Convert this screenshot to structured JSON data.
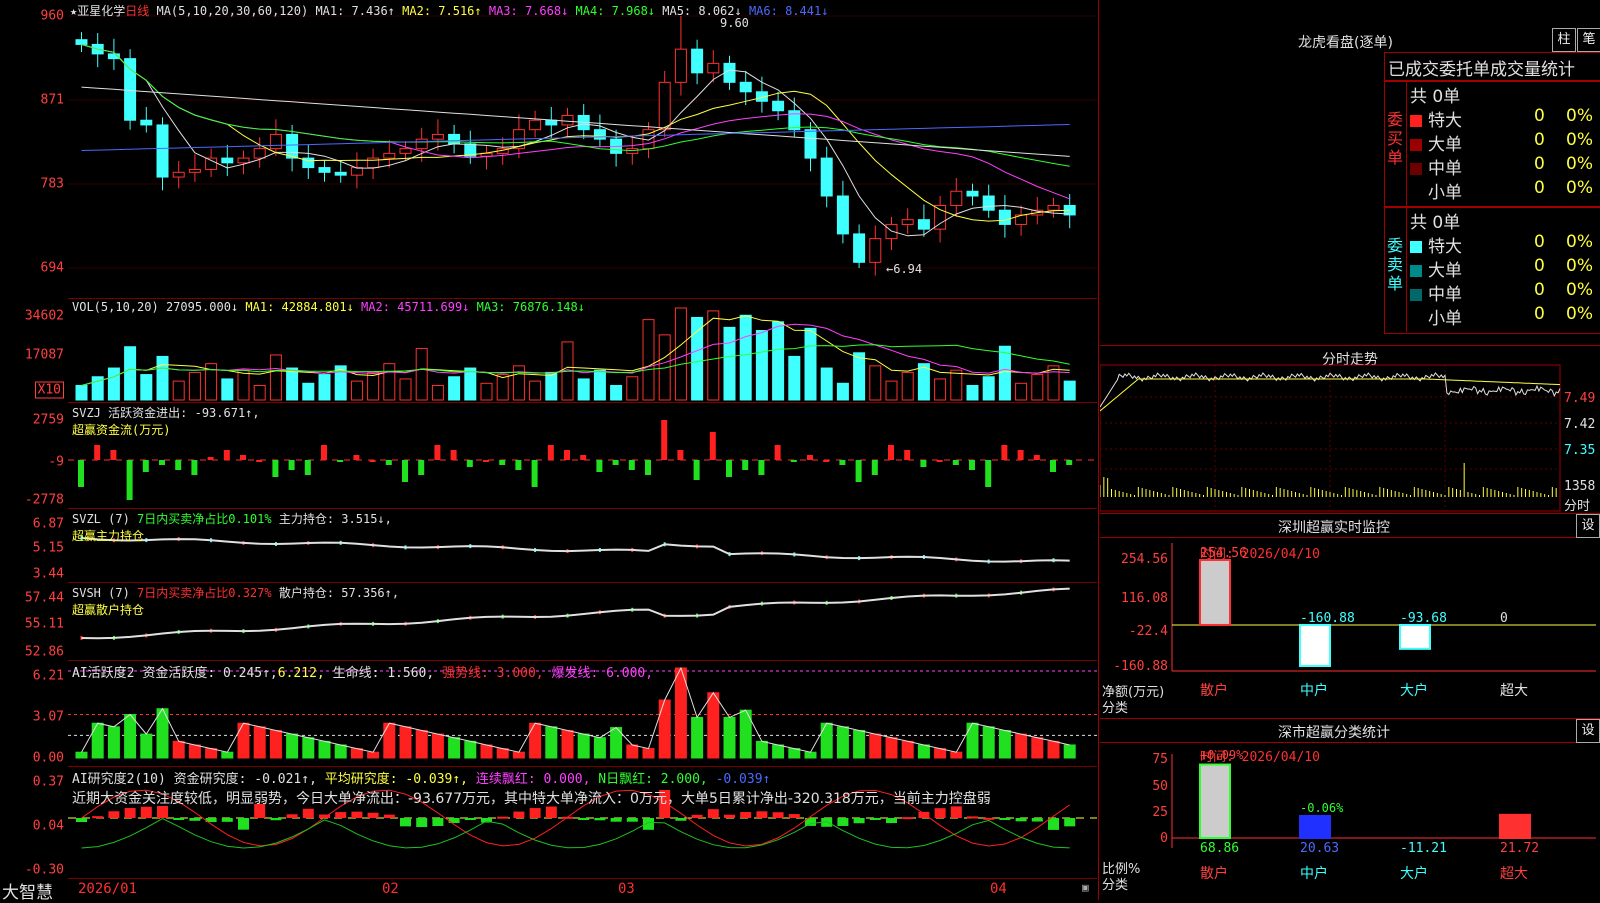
{
  "price": {
    "stock": "★亚星化学",
    "period": "日线",
    "ma_header": "MA(5,10,20,30,60,120)",
    "ma": [
      {
        "label": "MA1: 7.436↑",
        "color": "#e0e0e0"
      },
      {
        "label": "MA2: 7.516↑",
        "color": "#ffff40"
      },
      {
        "label": "MA3: 7.668↓",
        "color": "#ff40ff"
      },
      {
        "label": "MA4: 7.968↓",
        "color": "#30ff30"
      },
      {
        "label": "MA5: 8.062↓",
        "color": "#e0e0e0"
      },
      {
        "label": "MA6: 8.441↓",
        "color": "#4a6aff"
      }
    ],
    "axis": [
      "960",
      "871",
      "783",
      "694"
    ],
    "high_label": "9.60",
    "low_label": "←6.94"
  },
  "vol": {
    "header": "VOL(5,10,20)",
    "value": "27095.000↓",
    "ma": [
      {
        "label": "MA1: 42884.801↓",
        "color": "#ffff40"
      },
      {
        "label": "MA2: 45711.699↓",
        "color": "#ff40ff"
      },
      {
        "label": "MA3: 76876.148↓",
        "color": "#30ff30"
      }
    ],
    "axis": [
      "34602",
      "17087"
    ],
    "unit": "X10"
  },
  "svzj": {
    "header": "SVZJ",
    "label": "活跃资金进出: -93.671↑,",
    "sub": "超赢资金流(万元)",
    "axis": [
      "2759",
      "-9",
      "-2778"
    ]
  },
  "svzl": {
    "header": "SVZL (7)",
    "label": "7日内买卖净占比0.101%",
    "label2": "主力持仓: 3.515↓,",
    "sub": "超赢主力持仓",
    "axis": [
      "6.87",
      "5.15",
      "3.44"
    ]
  },
  "svsh": {
    "header": "SVSH (7)",
    "label": "7日内买卖净占比0.327%",
    "label2": "散户持仓: 57.356↑,",
    "sub": "超赢散户持仓",
    "axis": [
      "57.44",
      "55.11",
      "52.86"
    ]
  },
  "ai1": {
    "header": "AI活跃度2",
    "label": "资金活跃度: 0.245↑,",
    "v2": "6.212,",
    "v3": "生命线: 1.560,",
    "v4": "强势线: 3.000,",
    "v5": "爆发线: 6.000,",
    "axis": [
      "6.21",
      "3.07",
      "0.00"
    ]
  },
  "ai2": {
    "header": "AI研究度2(10)",
    "label": "资金研究度: -0.021↑,",
    "v2": "平均研究度: -0.039↑,",
    "v3": "连续飘红: 0.000,",
    "v4": "N日飘红: 2.000,",
    "v5": "-0.039↑",
    "desc": "近期大资金关注度较低，明显弱势，今日大单净流出：-93.677万元，其中特大单净流入：0万元，大单5日累计净出-320.318万元，当前主力控盘弱",
    "axis": [
      "0.37",
      "0.04",
      "-0.30"
    ]
  },
  "bottom": {
    "brand": "大智慧",
    "dates": [
      "2026/01",
      "02",
      "03",
      "04"
    ]
  },
  "lhb": {
    "title": "龙虎看盘(逐单)",
    "btn1": "柱",
    "btn2": "笔",
    "subtitle": "已成交委托单成交量统计",
    "buy": {
      "label": "委买单",
      "total": "共 0单",
      "rows": [
        {
          "name": "特大",
          "v": "0",
          "p": "0%",
          "color": "#ff2020"
        },
        {
          "name": "大单",
          "v": "0",
          "p": "0%",
          "color": "#9a0000"
        },
        {
          "name": "中单",
          "v": "0",
          "p": "0%",
          "color": "#6a0000"
        },
        {
          "name": "小单",
          "v": "0",
          "p": "0%",
          "color": "#000000"
        }
      ]
    },
    "sell": {
      "label": "委卖单",
      "total": "共 0单",
      "rows": [
        {
          "name": "特大",
          "v": "0",
          "p": "0%",
          "color": "#40ffff"
        },
        {
          "name": "大单",
          "v": "0",
          "p": "0%",
          "color": "#008a8a"
        },
        {
          "name": "中单",
          "v": "0",
          "p": "0%",
          "color": "#006868"
        },
        {
          "name": "小单",
          "v": "0",
          "p": "0%",
          "color": "#000000"
        }
      ]
    }
  },
  "intraday": {
    "title": "分时走势",
    "axis": [
      "7.49",
      "7.42",
      "7.35"
    ],
    "vol_axis": "1358",
    "vol_unit": "分时"
  },
  "sz_monitor": {
    "title": "深圳超赢实时监控",
    "btn": "设",
    "time": "时间: 2026/04/10",
    "axis": [
      "254.56",
      "116.08",
      "-22.4",
      "-160.88"
    ],
    "ylabel": "净额(万元)",
    "xlabel": "分类",
    "cats": [
      "散户",
      "中户",
      "大户",
      "超大"
    ],
    "values": [
      254.56,
      -160.88,
      -93.68,
      0
    ],
    "value_labels": [
      "254.56",
      "-160.88",
      "-93.68",
      "0"
    ]
  },
  "sz_class": {
    "title": "深市超赢分类统计",
    "btn": "设",
    "time": "时间: 2026/04/10",
    "axis": [
      "75",
      "50",
      "25",
      "0"
    ],
    "ylabel": "比例%",
    "xlabel": "分类",
    "top_labels": [
      "+0.09%",
      "-0.06%"
    ],
    "cats": [
      "散户",
      "中户",
      "大户",
      "超大"
    ],
    "values": [
      68.86,
      20.63,
      -11.21,
      21.72
    ],
    "value_labels": [
      "68.86",
      "20.63",
      "-11.21",
      "21.72"
    ]
  }
}
